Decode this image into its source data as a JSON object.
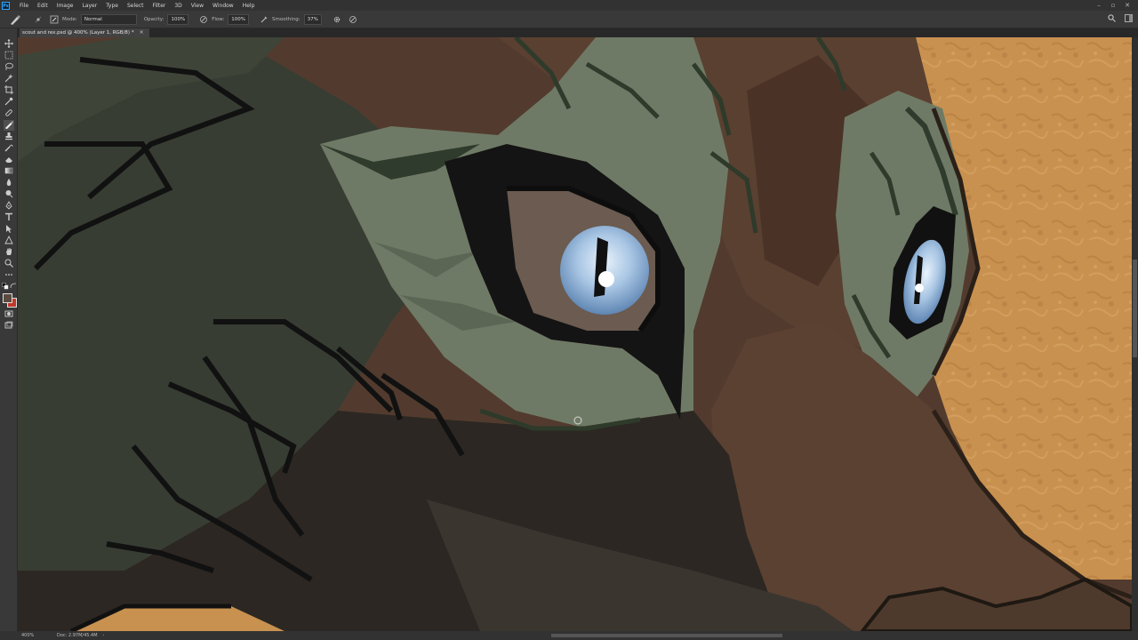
{
  "app": {
    "logo": "Ps"
  },
  "menu": [
    "File",
    "Edit",
    "Image",
    "Layer",
    "Type",
    "Select",
    "Filter",
    "3D",
    "View",
    "Window",
    "Help"
  ],
  "window_controls": [
    "–",
    "▫",
    "✕"
  ],
  "options": {
    "mode_label": "Mode:",
    "mode_value": "Normal",
    "opacity_label": "Opacity:",
    "opacity_value": "100%",
    "flow_label": "Flow:",
    "flow_value": "100%",
    "smoothing_label": "Smoothing:",
    "smoothing_value": "37%"
  },
  "document": {
    "tab_title": "scout and rex.psd @ 400% (Layer 1, RGB/8) *",
    "tab_close": "×"
  },
  "status": {
    "zoom": "400%",
    "doc_size": "Doc: 2.97M/45.4M",
    "arrow": "›"
  },
  "colors": {
    "foreground": "#5a4a3f",
    "background": "#c0392b",
    "accent": "#31a8ff"
  },
  "icons": {
    "tool_preset": "brush-icon",
    "toolbar": [
      "move-icon",
      "marquee-icon",
      "lasso-icon",
      "magic-wand-icon",
      "crop-icon",
      "eyedropper-icon",
      "healing-brush-icon",
      "brush-icon",
      "clone-stamp-icon",
      "history-brush-icon",
      "eraser-icon",
      "gradient-icon",
      "blur-icon",
      "dodge-icon",
      "pen-icon",
      "type-icon",
      "path-selection-icon",
      "shape-icon",
      "hand-icon",
      "zoom-icon",
      "more-tools-icon"
    ]
  }
}
